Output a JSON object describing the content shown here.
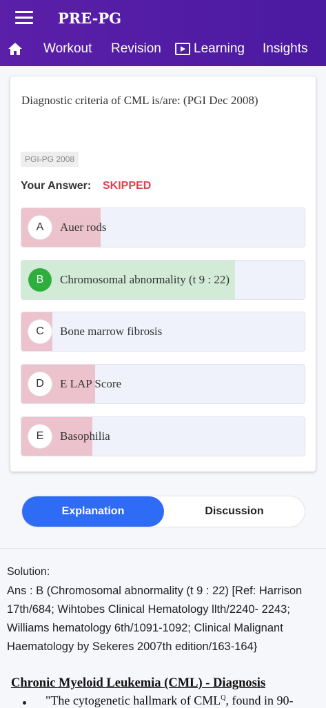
{
  "app": {
    "title": "PRE-PG"
  },
  "nav": {
    "items": [
      {
        "label": "Workout"
      },
      {
        "label": "Revision"
      },
      {
        "label": "Learning"
      },
      {
        "label": "Insights"
      }
    ]
  },
  "question": {
    "text": "Diagnostic criteria of CML is/are: (PGI Dec 2008)",
    "tag": "PGI-PG 2008",
    "your_answer_label": "Your Answer:",
    "your_answer_value": "SKIPPED",
    "options": [
      {
        "letter": "A",
        "text": "Auer rods",
        "percent": 28,
        "correct": false
      },
      {
        "letter": "B",
        "text": "Chromosomal abnormality (t 9 : 22)",
        "percent": 75.5,
        "correct": true
      },
      {
        "letter": "C",
        "text": "Bone marrow fibrosis",
        "percent": 11,
        "correct": false
      },
      {
        "letter": "D",
        "text": "E LAP Score",
        "percent": 26,
        "correct": false
      },
      {
        "letter": "E",
        "text": "Basophilia",
        "percent": 25,
        "correct": false
      }
    ]
  },
  "tabs": {
    "explanation": "Explanation",
    "discussion": "Discussion"
  },
  "solution": {
    "title": "Solution:",
    "text": "Ans : B (Chromosomal abnormality (t 9 : 22) [Ref: Harrison 17th/684; Wihtobes Clinical Hematology llth/2240- 2243; Williams hematology 6th/1091-1092; Clinical Malignant Haematology by Sekeres 2007th edition/163-164}",
    "heading": "Chronic Myeloid Leukemia (CML) - Diagnosis",
    "bullet_pre": "\"The cytogenetic hallmark of CML",
    "bullet_sup": "Q",
    "bullet_post": ", found in 90-"
  },
  "colors": {
    "appbar": "#5b1fa8",
    "wrong_fill": "#ecc3cc",
    "correct_fill": "#d2ebd6",
    "correct_badge": "#2eae3c",
    "accent": "#2f6cf6",
    "skipped": "#e0404b"
  },
  "icons": {
    "menu": "menu-icon",
    "home": "home-icon",
    "learning": "play-screen-icon"
  }
}
